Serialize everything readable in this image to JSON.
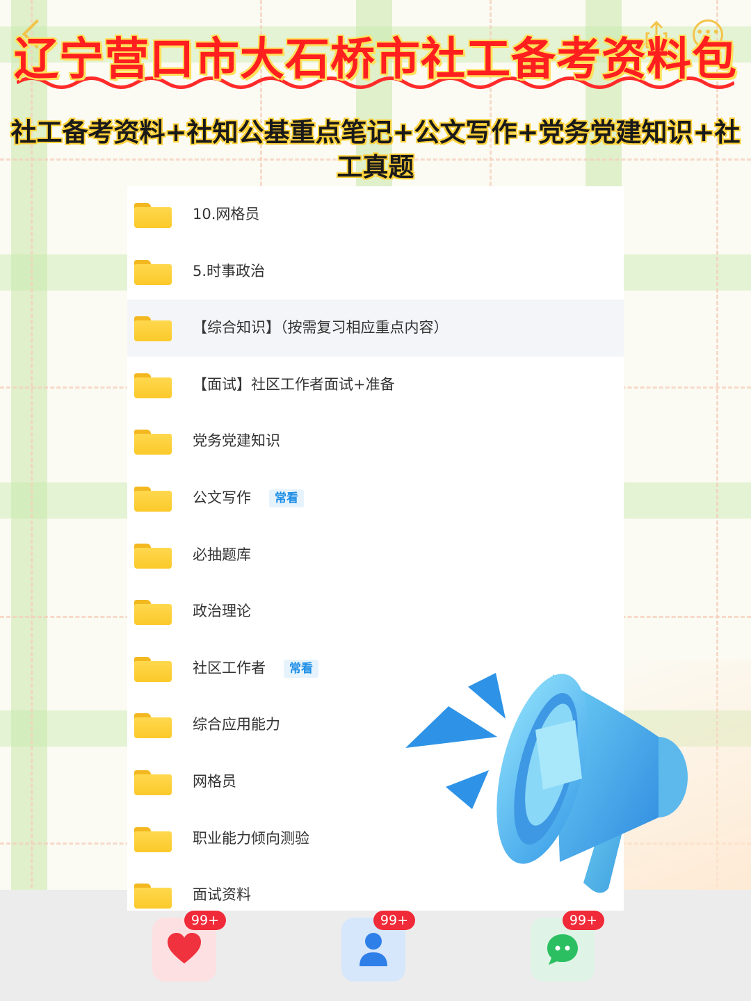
{
  "header": {
    "title": "辽宁营口市大石桥市社工备考资料包",
    "subtitle": "社工备考资料+社知公基重点笔记+公文写作+党务党建知识+社工真题"
  },
  "colors": {
    "title_red": "#ff1f1f",
    "highlight_yellow": "#ffd23a",
    "folder_yellow": "#fbc92a",
    "tag_blue": "#1e8fe6",
    "badge_red": "#f02a38"
  },
  "file_list": {
    "items": [
      {
        "label": "10.网格员",
        "tag": ""
      },
      {
        "label": "5.时事政治",
        "tag": ""
      },
      {
        "label": "【综合知识】（按需复习相应重点内容）",
        "tag": ""
      },
      {
        "label": "【面试】社区工作者面试+准备",
        "tag": ""
      },
      {
        "label": "党务党建知识",
        "tag": ""
      },
      {
        "label": "公文写作",
        "tag": "常看"
      },
      {
        "label": "必抽题库",
        "tag": ""
      },
      {
        "label": "政治理论",
        "tag": ""
      },
      {
        "label": "社区工作者",
        "tag": "常看"
      },
      {
        "label": "综合应用能力",
        "tag": ""
      },
      {
        "label": "网格员",
        "tag": ""
      },
      {
        "label": "职业能力倾向测验",
        "tag": ""
      },
      {
        "label": "面试资料",
        "tag": ""
      }
    ]
  },
  "actions": {
    "like": {
      "count": "99+",
      "icon": "heart-icon"
    },
    "follow": {
      "count": "99+",
      "icon": "person-icon"
    },
    "comment": {
      "count": "99+",
      "icon": "chat-bubble-icon"
    }
  }
}
